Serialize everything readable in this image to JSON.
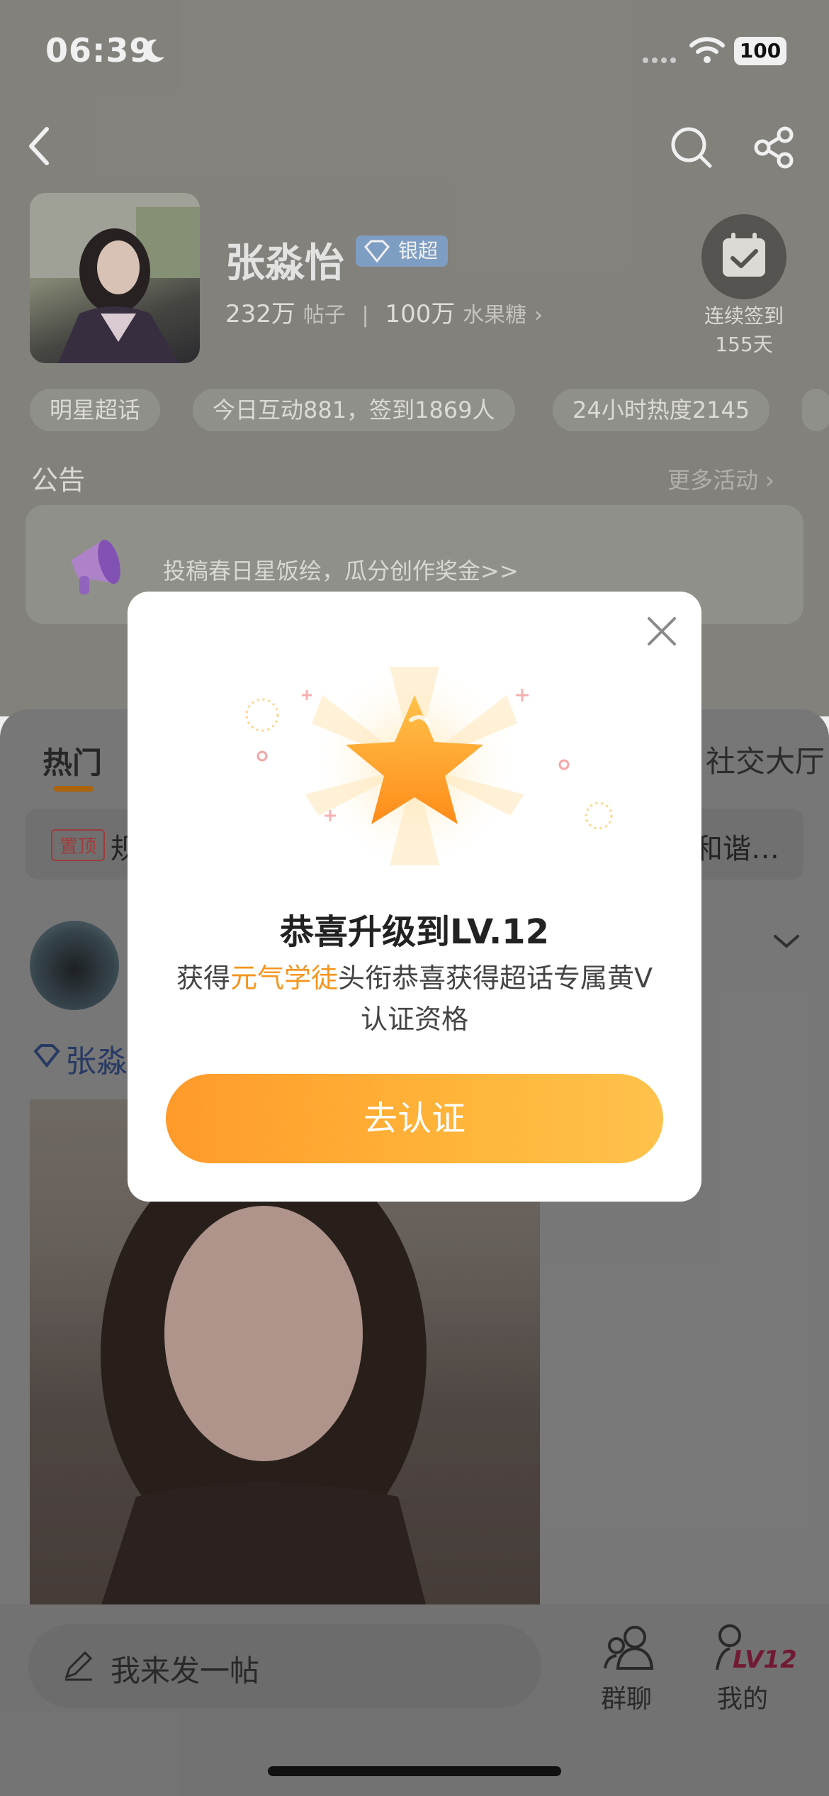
{
  "status_bar": {
    "time": "06:39",
    "battery": "100"
  },
  "header": {
    "name": "张淼怡",
    "badge": "银超",
    "posts_count": "232万",
    "posts_label": "帖子",
    "fans_count": "100万",
    "fans_label": "水果糖",
    "checkin_label": "连续签到",
    "checkin_days": "155天",
    "chips": [
      "明星超话",
      "今日互动881，签到1869人",
      "24小时热度2145"
    ],
    "announcement_title": "公告",
    "more_activity": "更多活动 ›",
    "announcement_text": "投稿春日星饭绘，瓜分创作奖金>>"
  },
  "content": {
    "tab_hot": "热门",
    "tab_social": "社交大厅",
    "pinned_tag": "置顶",
    "pinned_text": "规",
    "pinned_tail": "和谐…",
    "post_author_fragment": "张淼"
  },
  "bottom_bar": {
    "compose_placeholder": "我来发一帖",
    "group_chat": "群聊",
    "mine": "我的",
    "level_badge": "LV12"
  },
  "modal": {
    "title": "恭喜升级到LV.12",
    "desc_prefix": "获得",
    "desc_highlight": "元气学徒",
    "desc_suffix": "头衔恭喜获得超话专属黄V认证资格",
    "button": "去认证"
  },
  "colors": {
    "accent_orange": "#f5951e",
    "button_gradient_start": "#ff9a2a",
    "button_gradient_end": "#ffc24c",
    "overlay": "rgba(0,0,0,0.5)"
  }
}
